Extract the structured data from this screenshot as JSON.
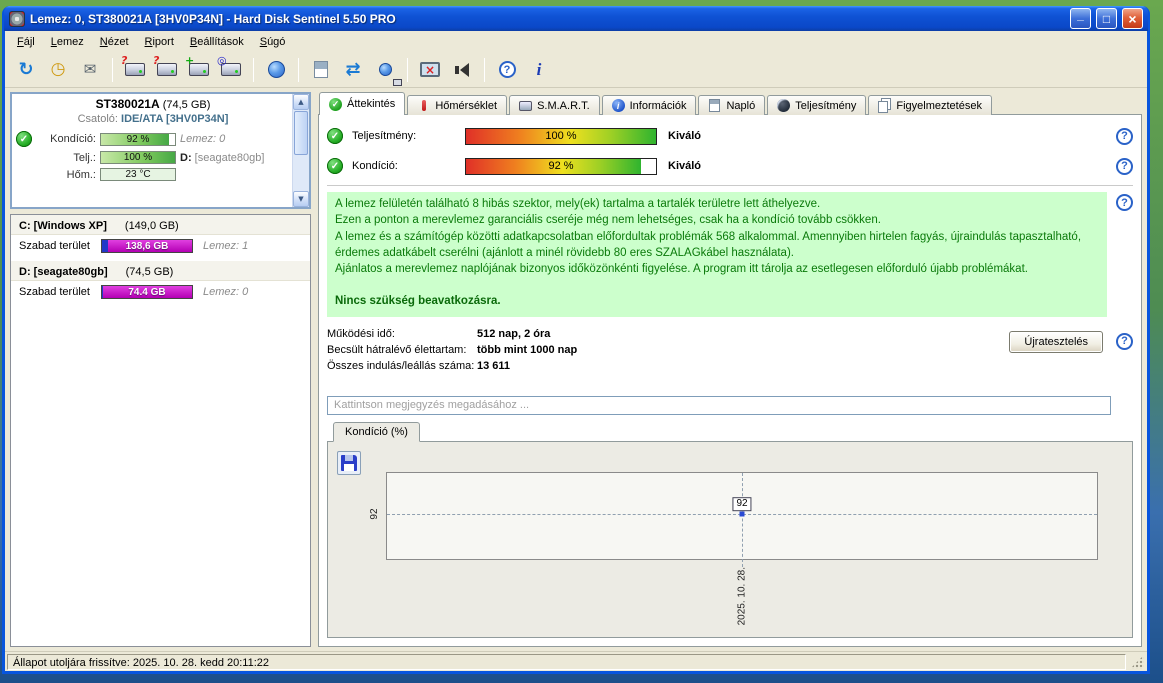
{
  "window": {
    "title": "Lemez: 0, ST380021A [3HV0P34N]  -  Hard Disk Sentinel 5.50 PRO",
    "buttons": {
      "minimize": "_",
      "maximize": "□",
      "close": "×"
    }
  },
  "menu": {
    "items": [
      "Fájl",
      "Lemez",
      "Nézet",
      "Riport",
      "Beállítások",
      "Súgó"
    ]
  },
  "toolbar": {
    "disk_badges": [
      "?",
      "?",
      "+",
      "◎"
    ],
    "icon_names": [
      "refresh-icon",
      "alarm-clock-icon",
      "monitor-message-icon",
      "disk-question-icon",
      "disk-alert-icon",
      "disk-add-icon",
      "disk-search-icon",
      "globe-icon",
      "report-icon",
      "disk-sync-icon",
      "globe-disk-icon",
      "display-off-icon",
      "speaker-icon",
      "help-icon",
      "info-icon"
    ]
  },
  "icons": {
    "check": "✓",
    "question": "?",
    "info": "i",
    "arrow_up": "▲",
    "arrow_down": "▼",
    "refresh": "↻",
    "sync": "⇄",
    "mail": "✉",
    "clock": "◷",
    "close_x": "×"
  },
  "sidebar": {
    "disk": {
      "model": "ST380021A",
      "size": "(74,5 GB)",
      "connector_label": "Csatoló:",
      "connector_value": "IDE/ATA [3HV0P34N]",
      "condition_label": "Kondíció:",
      "condition_value": "92 %",
      "condition_percent": 92,
      "condition_note": "Lemez: 0",
      "perf_label": "Telj.:",
      "perf_value": "100 %",
      "perf_percent": 100,
      "perf_note_prefix": "D:",
      "perf_note_value": "[seagate80gb]",
      "temp_label": "Hőm.:",
      "temp_value": "23 °C"
    },
    "partitions": [
      {
        "title": "C: [Windows XP]",
        "size": "(149,0 GB)",
        "free_label": "Szabad terület",
        "free_value": "138,6 GB",
        "used_percent": 7,
        "free_percent": 93,
        "note": "Lemez: 1"
      },
      {
        "title": "D: [seagate80gb]",
        "size": "(74,5 GB)",
        "free_label": "Szabad terület",
        "free_value": "74.4 GB",
        "used_percent": 1,
        "free_percent": 99,
        "note": "Lemez: 0"
      }
    ]
  },
  "tabs": {
    "items": [
      {
        "label": "Áttekintés"
      },
      {
        "label": "Hőmérséklet"
      },
      {
        "label": "S.M.A.R.T."
      },
      {
        "label": "Információk"
      },
      {
        "label": "Napló"
      },
      {
        "label": "Teljesítmény"
      },
      {
        "label": "Figyelmeztetések"
      }
    ],
    "active": "Áttekintés"
  },
  "overview": {
    "performance": {
      "label": "Teljesítmény:",
      "value": "100 %",
      "percent": 100,
      "rating": "Kiváló"
    },
    "condition": {
      "label": "Kondíció:",
      "value": "92 %",
      "percent": 92,
      "rating": "Kiváló"
    },
    "message": {
      "lines": [
        "A lemez felületén található 8 hibás szektor, mely(ek) tartalma a tartalék területre lett áthelyezve.",
        "Ezen a ponton a merevlemez garanciális cseréje még nem lehetséges, csak ha a kondíció tovább csökken.",
        "A lemez és a számítógép közötti adatkapcsolatban előfordultak problémák 568 alkalommal. Amennyiben hirtelen fagyás, újraindulás tapasztalható, érdemes adatkábelt cserélni (ajánlott a minél rövidebb 80 eres SZALAGkábel használata).",
        "Ajánlatos a merevlemez naplójának bizonyos időközönkénti figyelése. A program itt tárolja az esetlegesen előforduló újabb problémákat."
      ],
      "action": "Nincs szükség beavatkozásra."
    },
    "stats": [
      {
        "label": "Működési idő:",
        "value": "512 nap, 2 óra"
      },
      {
        "label": "Becsült hátralévő élettartam:",
        "value": "több mint 1000 nap"
      },
      {
        "label": "Összes indulás/leállás száma:",
        "value": "13 611"
      }
    ],
    "retest_button": "Újratesztelés",
    "comment_placeholder": "Kattintson megjegyzés megadásához ..."
  },
  "chart_data": {
    "type": "line",
    "title": "Kondíció  (%)",
    "x": [
      "2025. 10. 28."
    ],
    "series": [
      {
        "name": "Kondíció",
        "values": [
          92
        ]
      }
    ],
    "ylim": [
      0,
      100
    ],
    "y_tick": "92",
    "point_label": "92",
    "grid": "dashed"
  },
  "status_bar": {
    "text": "Állapot utoljára frissítve: 2025. 10. 28. kedd 20:11:22"
  },
  "colors": {
    "titlebar_blue": "#0a52d6",
    "free_space_bar": "#c400c4",
    "used_space_bar": "#2238c8",
    "health_bar_green": "#46a846",
    "message_bg": "#ccffcc",
    "message_text": "#0a7a0a"
  }
}
